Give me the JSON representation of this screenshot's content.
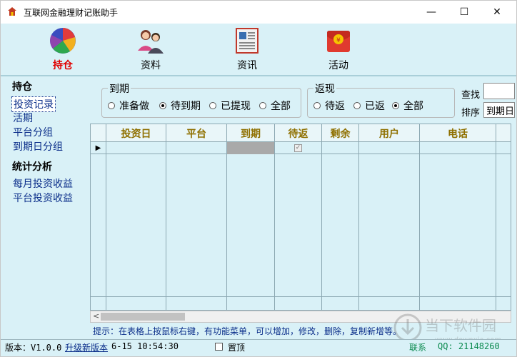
{
  "window": {
    "title": "互联网金融理财记账助手",
    "controls": {
      "minimize": "—",
      "maximize": "☐",
      "close": "✕"
    }
  },
  "toolbar": {
    "items": [
      {
        "label": "持仓",
        "icon": "pie-chart-icon",
        "active": true
      },
      {
        "label": "资料",
        "icon": "users-icon",
        "active": false
      },
      {
        "label": "资讯",
        "icon": "news-icon",
        "active": false
      },
      {
        "label": "活动",
        "icon": "red-envelope-icon",
        "active": false
      }
    ]
  },
  "sidebar": {
    "section1_title": "持仓",
    "section1_items": [
      "投资记录",
      "活期",
      "平台分组",
      "到期日分组"
    ],
    "section2_title": "统计分析",
    "section2_items": [
      "每月投资收益",
      "平台投资收益"
    ],
    "selected": "投资记录"
  },
  "filters": {
    "due_group": {
      "title": "到期",
      "options": [
        "准备做",
        "待到期",
        "已提现",
        "全部"
      ],
      "selected": "待到期"
    },
    "rebate_group": {
      "title": "返现",
      "options": [
        "待返",
        "已返",
        "全部"
      ],
      "selected": "全部"
    },
    "search_label": "查找",
    "search_value": "",
    "sort_label": "排序",
    "sort_value": "到期日"
  },
  "table": {
    "columns": [
      "投资日",
      "平台",
      "到期",
      "待返",
      "剩余",
      "用户",
      "电话"
    ],
    "row": {
      "待返_checked": true
    }
  },
  "hint": "提示：在表格上按鼠标右键，有功能菜单，可以增加，修改，删除，复制新增等。",
  "status": {
    "version_label": "版本：V1.0.0",
    "upgrade_link": "升级新版本",
    "datetime": "6-15 10:54:30",
    "pin_label": "置顶",
    "contact_label": "联系",
    "qq": "QQ: 21148260"
  },
  "watermark": {
    "text": "当下软件园",
    "sub": "www.downxia.com"
  }
}
